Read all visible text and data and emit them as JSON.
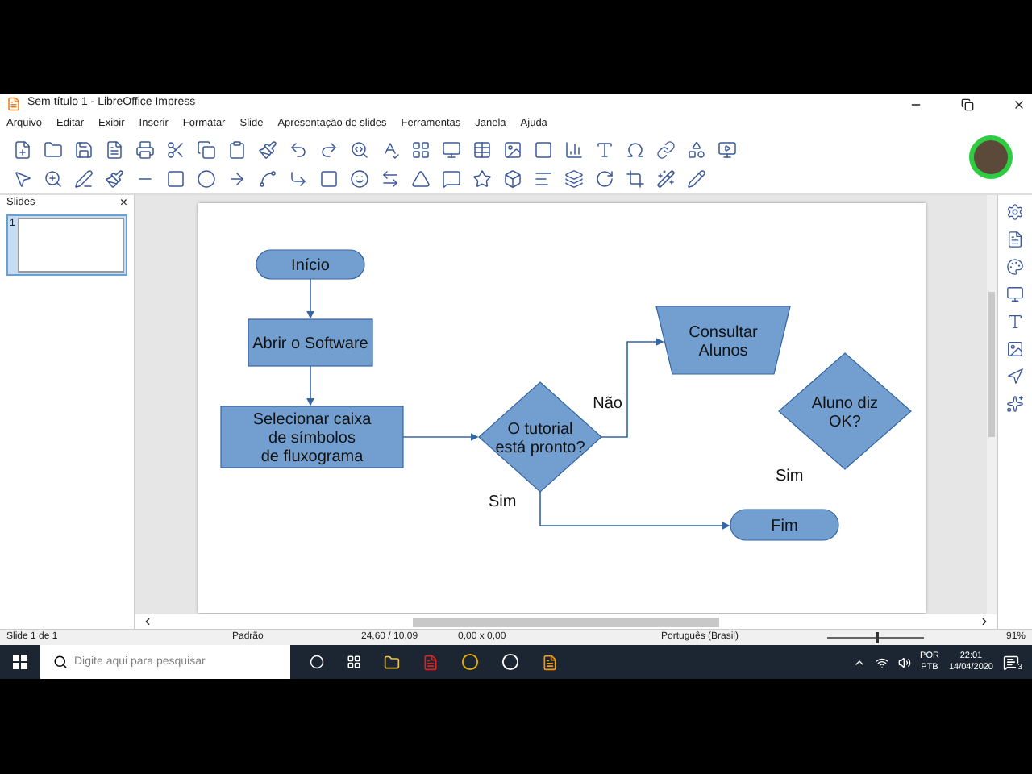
{
  "window": {
    "title": "Sem título 1 - LibreOffice Impress"
  },
  "menu": [
    "Arquivo",
    "Editar",
    "Exibir",
    "Inserir",
    "Formatar",
    "Slide",
    "Apresentação de slides",
    "Ferramentas",
    "Janela",
    "Ajuda"
  ],
  "slides_panel": {
    "title": "Slides",
    "close": "×",
    "thumbnails": [
      {
        "number": "1",
        "selected": true
      }
    ]
  },
  "flowchart": {
    "nodes": [
      {
        "kind": "terminal",
        "lines": [
          "Início"
        ]
      },
      {
        "kind": "process",
        "lines": [
          "Abrir o Software"
        ]
      },
      {
        "kind": "process",
        "lines": [
          "Selecionar caixa",
          "de símbolos",
          "de fluxograma"
        ]
      },
      {
        "kind": "decision",
        "lines": [
          "O tutorial",
          "está pronto?"
        ]
      },
      {
        "kind": "manual",
        "lines": [
          "Consultar",
          "Alunos"
        ]
      },
      {
        "kind": "decision",
        "lines": [
          "Aluno diz",
          "OK?"
        ]
      },
      {
        "kind": "terminal",
        "lines": [
          "Fim"
        ]
      }
    ],
    "labels": [
      "Não",
      "Sim",
      "Sim"
    ]
  },
  "status_bar": {
    "slide": "Slide 1 de 1",
    "layout": "Padrão",
    "position": "24,60 / 10,09",
    "size": "0,00 x 0,00",
    "language": "Português (Brasil)",
    "zoom": "91%",
    "zoom_slider": {
      "level": 0.5
    }
  },
  "taskbar": {
    "search": {
      "placeholder": "Digite aqui para pesquisar"
    },
    "input_lang": [
      "POR",
      "PTB"
    ],
    "time": "22:01",
    "date": "14/04/2020",
    "notifications": "3"
  }
}
